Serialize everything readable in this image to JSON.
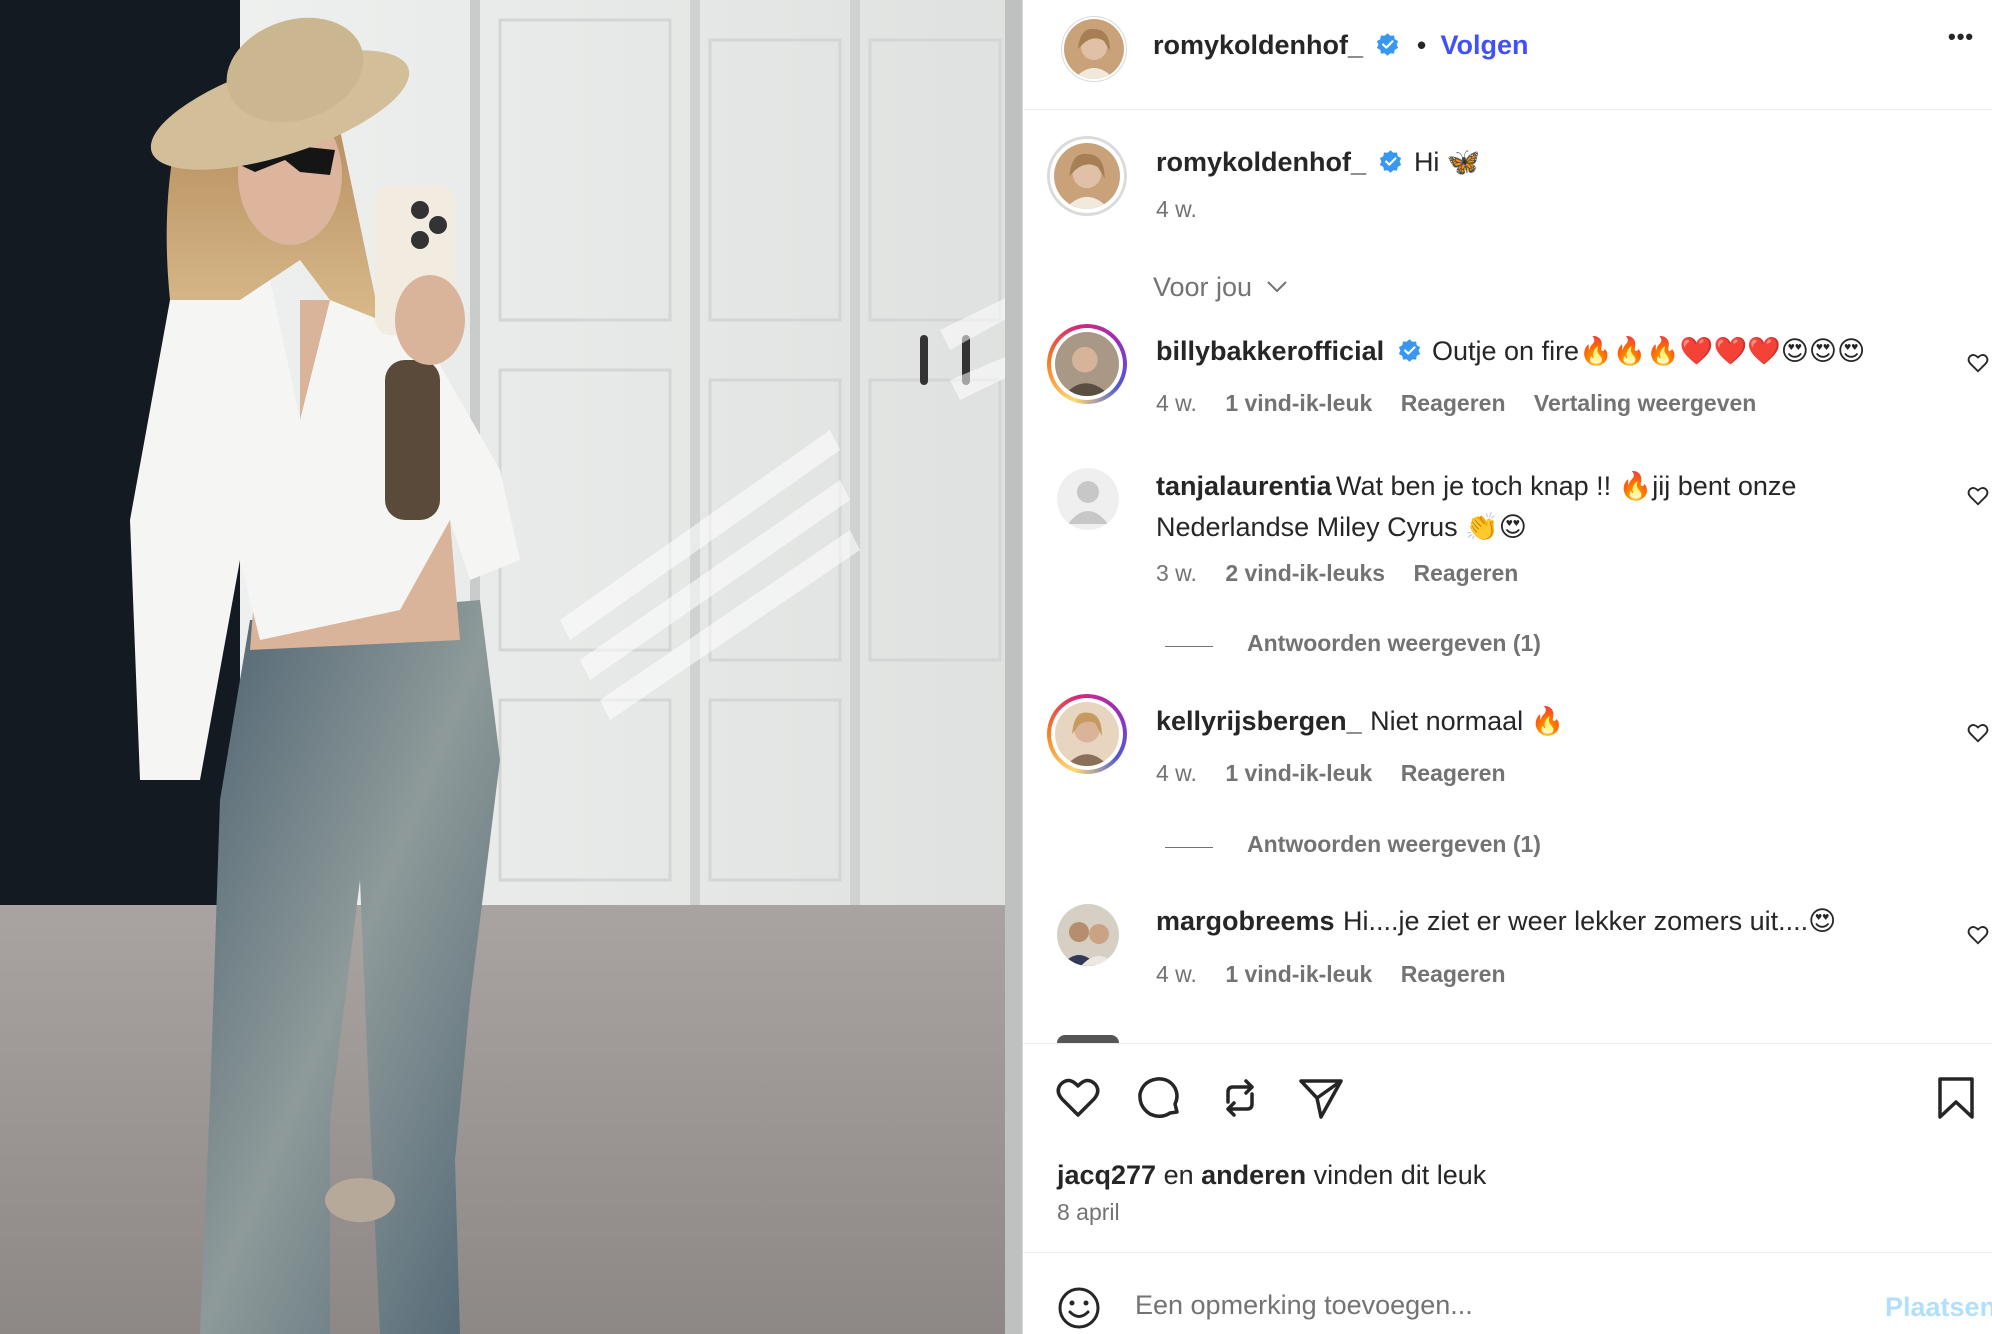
{
  "post": {
    "author": "romykoldenhof_",
    "follow_label": "Volgen",
    "separator": "•",
    "more_label": "•••",
    "caption": "Hi 🦋",
    "caption_time": "4 w.",
    "sort_label": "Voor jou",
    "likes_user": "jacq277",
    "likes_rest_1": " en ",
    "likes_others": "anderen",
    "likes_rest_2": " vinden dit leuk",
    "date": "8 april",
    "comment_placeholder": "Een opmerking toevoegen...",
    "post_label": "Plaatsen"
  },
  "comments": [
    {
      "user": "billybakkerofficial",
      "verified": true,
      "text": "Outje on fire🔥🔥🔥❤️❤️❤️😍😍😍",
      "time": "4 w.",
      "likes": "1 vind-ik-leuk",
      "reply": "Reageren",
      "translate": "Vertaling weergeven"
    },
    {
      "user": "tanjalaurentia",
      "text_line1": "Wat ben je toch knap !! 🔥jij bent onze",
      "text_line2": "Nederlandse Miley Cyrus 👏😍",
      "time": "3 w.",
      "likes": "2 vind-ik-leuks",
      "reply": "Reageren",
      "replies": "Antwoorden weergeven (1)"
    },
    {
      "user": "kellyrijsbergen_",
      "text": "Niet normaal 🔥",
      "time": "4 w.",
      "likes": "1 vind-ik-leuk",
      "reply": "Reageren",
      "replies": "Antwoorden weergeven (1)"
    },
    {
      "user": "margobreems",
      "text": "Hi....je ziet er weer lekker zomers uit....😍",
      "time": "4 w.",
      "likes": "1 vind-ik-leuk",
      "reply": "Reageren"
    }
  ],
  "icons": {
    "verified": "verified-badge-icon",
    "like": "heart-icon",
    "comment": "comment-icon",
    "repost": "repost-icon",
    "share": "send-icon",
    "save": "bookmark-icon",
    "emoji": "emoji-icon",
    "chevron": "chevron-down-icon"
  },
  "colors": {
    "follow": "#4150f7",
    "verified": "#3897f0",
    "muted": "#737373",
    "post_disabled": "#b2dffc"
  }
}
